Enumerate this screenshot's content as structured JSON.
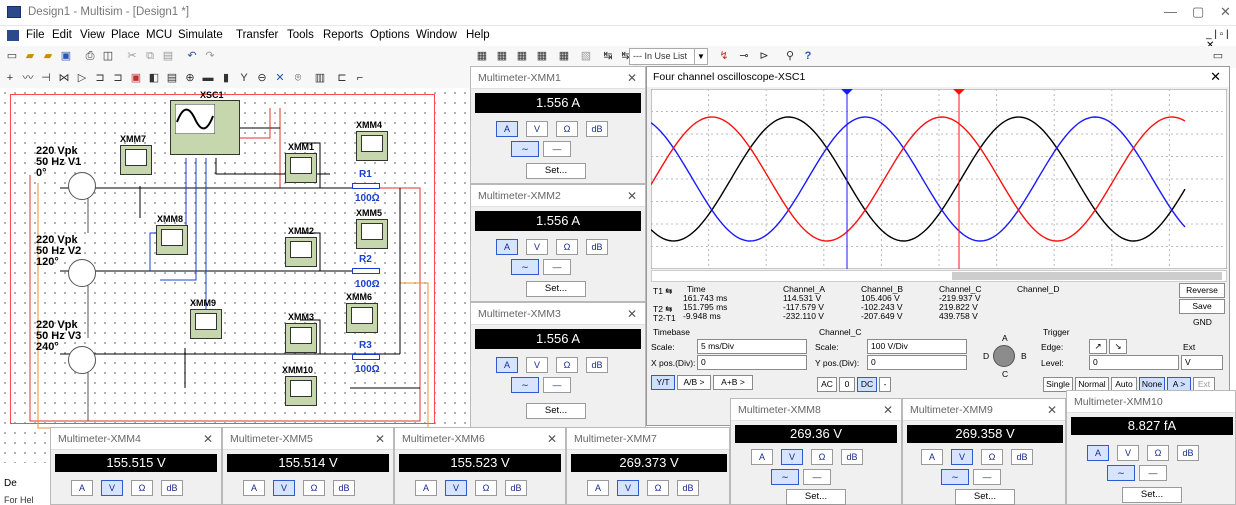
{
  "window": {
    "title": "Design1 - Multisim - [Design1 *]"
  },
  "menu": [
    "File",
    "Edit",
    "View",
    "Place",
    "MCU",
    "Simulate",
    "Transfer",
    "Tools",
    "Reports",
    "Options",
    "Window",
    "Help"
  ],
  "toolbar": {
    "in_use_list": "--- In Use List ---"
  },
  "schematic": {
    "oscilloscope": "XSC1",
    "meters": [
      "XMM7",
      "XMM1",
      "XMM4",
      "XMM8",
      "XMM2",
      "XMM5",
      "XMM9",
      "XMM3",
      "XMM6",
      "XMM10"
    ],
    "resistors": [
      {
        "name": "R1",
        "value": "100Ω"
      },
      {
        "name": "R2",
        "value": "100Ω"
      },
      {
        "name": "R3",
        "value": "100Ω"
      }
    ],
    "sources": [
      {
        "amp": "220 Vpk",
        "freq": "50 Hz",
        "name": "V1",
        "phase": "0°"
      },
      {
        "amp": "220 Vpk",
        "freq": "50 Hz",
        "name": "V2",
        "phase": "120°"
      },
      {
        "amp": "220 Vpk",
        "freq": "50 Hz",
        "name": "V3",
        "phase": "240°"
      }
    ]
  },
  "multimeters": [
    {
      "title": "Multimeter-XMM1",
      "value": "1.556 A",
      "mode": "A"
    },
    {
      "title": "Multimeter-XMM2",
      "value": "1.556 A",
      "mode": "A"
    },
    {
      "title": "Multimeter-XMM3",
      "value": "1.556 A",
      "mode": "A"
    },
    {
      "title": "Multimeter-XMM4",
      "value": "155.515 V",
      "mode": "V"
    },
    {
      "title": "Multimeter-XMM5",
      "value": "155.514 V",
      "mode": "V"
    },
    {
      "title": "Multimeter-XMM6",
      "value": "155.523 V",
      "mode": "V"
    },
    {
      "title": "Multimeter-XMM7",
      "value": "269.373 V",
      "mode": "V"
    },
    {
      "title": "Multimeter-XMM8",
      "value": "269.36 V",
      "mode": "V"
    },
    {
      "title": "Multimeter-XMM9",
      "value": "269.358 V",
      "mode": "V"
    },
    {
      "title": "Multimeter-XMM10",
      "value": "8.827 fA",
      "mode": "A"
    }
  ],
  "meter_labels": {
    "a": "A",
    "v": "V",
    "ohm": "Ω",
    "db": "dB",
    "set": "Set..."
  },
  "scope": {
    "title": "Four channel oscilloscope-XSC1",
    "headers": [
      "Time",
      "Channel_A",
      "Channel_B",
      "Channel_C",
      "Channel_D"
    ],
    "rows": [
      {
        "label": "T1",
        "time": "161.743 ms",
        "a": "114.531 V",
        "b": "105.406 V",
        "c": "-219.937 V"
      },
      {
        "label": "T2",
        "time": "151.795 ms",
        "a": "-117.579 V",
        "b": "-102.243 V",
        "c": "219.822 V"
      },
      {
        "label": "T2-T1",
        "time": "-9.948 ms",
        "a": "-232.110 V",
        "b": "-207.649 V",
        "c": "439.758 V"
      }
    ],
    "buttons": {
      "reverse": "Reverse",
      "save": "Save",
      "gnd": "GND"
    },
    "timebase": {
      "label": "Timebase",
      "scale_label": "Scale:",
      "scale": "5 ms/Div",
      "xpos_label": "X pos.(Div):",
      "xpos": "0",
      "modes": [
        "Y/T",
        "A/B >",
        "A+B >"
      ]
    },
    "channel": {
      "label": "Channel_C",
      "scale_label": "Scale:",
      "scale": "100 V/Div",
      "ypos_label": "Y pos.(Div):",
      "ypos": "0",
      "coupling": [
        "AC",
        "0",
        "DC",
        "-"
      ],
      "knob": [
        "A",
        "B",
        "C",
        "D"
      ]
    },
    "trigger": {
      "label": "Trigger",
      "edge_label": "Edge:",
      "level_label": "Level:",
      "level": "0",
      "unit": "V",
      "ext": "Ext",
      "modes": [
        "Single",
        "Normal",
        "Auto",
        "None",
        "A >",
        "Ext"
      ]
    },
    "colors": {
      "a": "#000000",
      "b": "#1a1aff",
      "c": "#ff1010"
    }
  },
  "status": {
    "left": "For Hel",
    "tab": "De"
  }
}
